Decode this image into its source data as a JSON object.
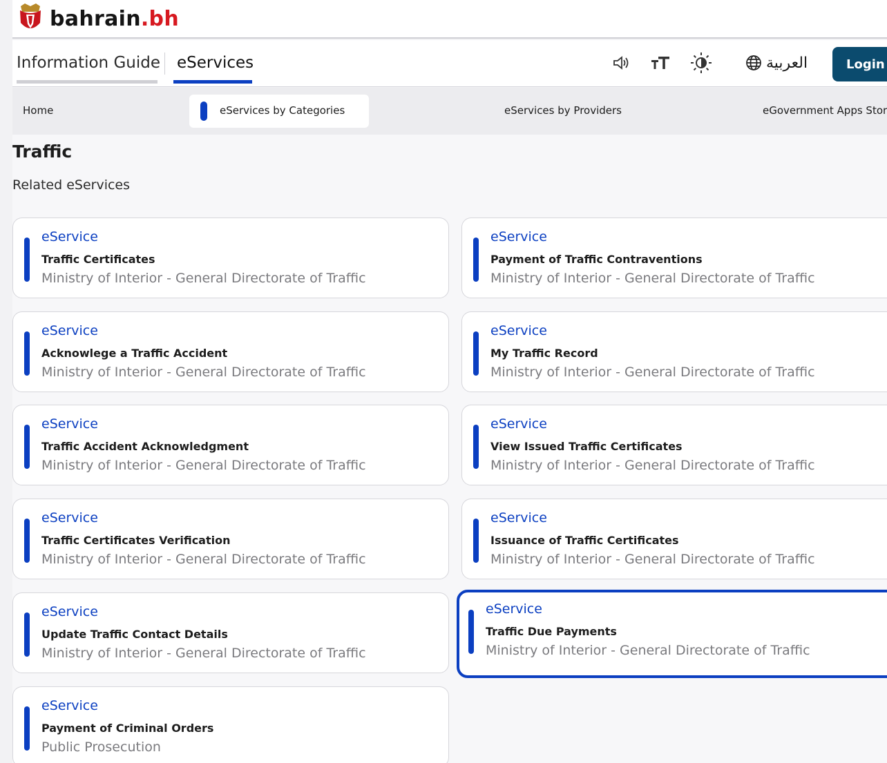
{
  "brand": {
    "name": "bahrain",
    "tld": ".bh"
  },
  "mainnav": {
    "tabs": [
      {
        "label": "Information Guide"
      },
      {
        "label": "eServices"
      }
    ],
    "language_label": "العربية",
    "login_label": "Login",
    "icons": [
      "speaker-icon",
      "text-size-icon",
      "brightness-icon",
      "globe-icon"
    ]
  },
  "subnav": {
    "items": [
      {
        "label": "Home"
      },
      {
        "label": "eServices by Categories"
      },
      {
        "label": "eServices by Providers"
      },
      {
        "label": "eGovernment Apps Store"
      }
    ]
  },
  "content": {
    "title": "Traffic",
    "subtitle": "Related eServices",
    "cards": [
      {
        "kind": "eService",
        "name": "Traffic Certificates",
        "provider": "Ministry of Interior - General Directorate of Traffic"
      },
      {
        "kind": "eService",
        "name": "Payment of Traffic Contraventions",
        "provider": "Ministry of Interior - General Directorate of Traffic"
      },
      {
        "kind": "eService",
        "name": "Acknowlege a Traffic Accident",
        "provider": "Ministry of Interior - General Directorate of Traffic"
      },
      {
        "kind": "eService",
        "name": "My Traffic Record",
        "provider": "Ministry of Interior - General Directorate of Traffic"
      },
      {
        "kind": "eService",
        "name": "Traffic Accident Acknowledgment",
        "provider": "Ministry of Interior - General Directorate of Traffic"
      },
      {
        "kind": "eService",
        "name": "View Issued Traffic Certificates",
        "provider": "Ministry of Interior - General Directorate of Traffic"
      },
      {
        "kind": "eService",
        "name": "Traffic Certificates Verification",
        "provider": "Ministry of Interior - General Directorate of Traffic"
      },
      {
        "kind": "eService",
        "name": "Issuance of Traffic Certificates",
        "provider": "Ministry of Interior - General Directorate of Traffic"
      },
      {
        "kind": "eService",
        "name": "Update Traffic Contact Details",
        "provider": "Ministry of Interior - General Directorate of Traffic"
      },
      {
        "kind": "eService",
        "name": "Traffic Due Payments",
        "provider": "Ministry of Interior - General Directorate of Traffic"
      },
      {
        "kind": "eService",
        "name": "Payment of Criminal Orders",
        "provider": "Public Prosecution"
      }
    ]
  },
  "colors": {
    "accent": "#0b3fc1",
    "brand_red": "#d71920",
    "login_bg": "#0b4b6e"
  }
}
